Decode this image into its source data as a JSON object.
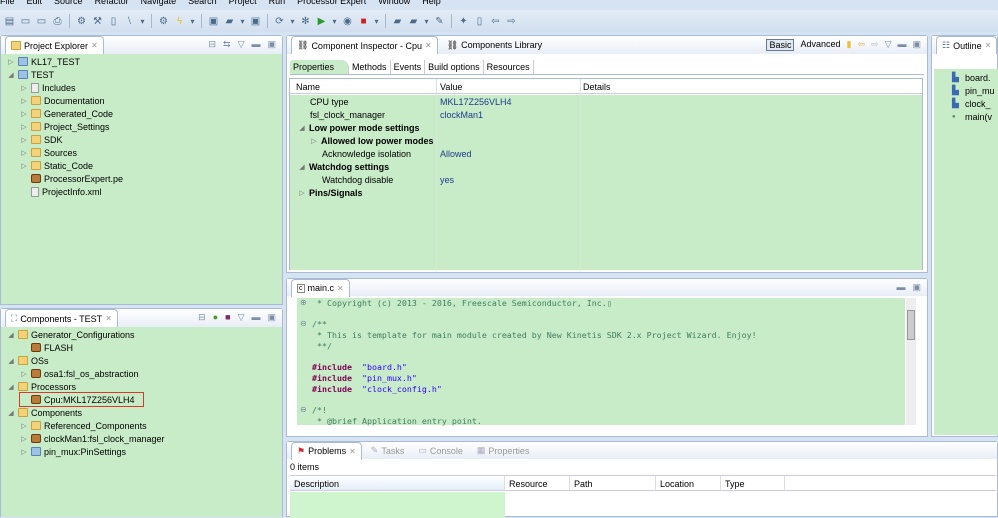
{
  "menu": [
    "File",
    "Edit",
    "Source",
    "Refactor",
    "Navigate",
    "Search",
    "Project",
    "Run",
    "Processor Expert",
    "Window",
    "Help"
  ],
  "toolbar_icons": [
    "new-icon",
    "save-icon",
    "save-all-icon",
    "print-icon",
    "build-config-icon",
    "hammer-icon",
    "binary-icon",
    "skip-breakpoints-icon",
    "external-tools-icon",
    "lightning-icon",
    "new-c-project-icon",
    "new-folder-icon",
    "new-class-icon",
    "refresh-icon",
    "debug-icon",
    "run-icon",
    "coverage-icon",
    "stop-icon",
    "open-icon",
    "open-folder-icon",
    "wrench-icon",
    "annotation-icon",
    "next-edit-icon",
    "back-icon",
    "forward-icon"
  ],
  "project_explorer": {
    "title": "Project Explorer",
    "items": [
      {
        "label": "KL17_TEST",
        "icon": "project",
        "depth": 0,
        "twisty": "collapsed"
      },
      {
        "label": "TEST",
        "icon": "project",
        "depth": 0,
        "twisty": "expanded"
      },
      {
        "label": "Includes",
        "icon": "includes",
        "depth": 1,
        "twisty": "collapsed"
      },
      {
        "label": "Documentation",
        "icon": "folder",
        "depth": 1,
        "twisty": "collapsed"
      },
      {
        "label": "Generated_Code",
        "icon": "folder",
        "depth": 1,
        "twisty": "collapsed"
      },
      {
        "label": "Project_Settings",
        "icon": "folder",
        "depth": 1,
        "twisty": "collapsed"
      },
      {
        "label": "SDK",
        "icon": "folder",
        "depth": 1,
        "twisty": "collapsed"
      },
      {
        "label": "Sources",
        "icon": "folder",
        "depth": 1,
        "twisty": "collapsed"
      },
      {
        "label": "Static_Code",
        "icon": "folder",
        "depth": 1,
        "twisty": "collapsed"
      },
      {
        "label": "ProcessorExpert.pe",
        "icon": "pe",
        "depth": 1,
        "twisty": ""
      },
      {
        "label": "ProjectInfo.xml",
        "icon": "file",
        "depth": 1,
        "twisty": ""
      }
    ]
  },
  "components": {
    "title": "Components - TEST",
    "items": [
      {
        "label": "Generator_Configurations",
        "icon": "folder",
        "depth": 0,
        "twisty": "expanded"
      },
      {
        "label": "FLASH",
        "icon": "gear",
        "depth": 1,
        "twisty": ""
      },
      {
        "label": "OSs",
        "icon": "folder",
        "depth": 0,
        "twisty": "expanded"
      },
      {
        "label": "osa1:fsl_os_abstraction",
        "icon": "component",
        "depth": 1,
        "twisty": "collapsed"
      },
      {
        "label": "Processors",
        "icon": "folder",
        "depth": 0,
        "twisty": "expanded"
      },
      {
        "label": "Cpu:MKL17Z256VLH4",
        "icon": "cpu",
        "depth": 1,
        "twisty": "",
        "highlighted": true
      },
      {
        "label": "Components",
        "icon": "folder",
        "depth": 0,
        "twisty": "expanded"
      },
      {
        "label": "Referenced_Components",
        "icon": "folder",
        "depth": 1,
        "twisty": "collapsed"
      },
      {
        "label": "clockMan1:fsl_clock_manager",
        "icon": "component",
        "depth": 1,
        "twisty": "collapsed"
      },
      {
        "label": "pin_mux:PinSettings",
        "icon": "pins",
        "depth": 1,
        "twisty": "collapsed"
      }
    ]
  },
  "inspector": {
    "tabs": [
      "Component Inspector - Cpu",
      "Components Library"
    ],
    "modes": [
      "Basic",
      "Advanced"
    ],
    "subtabs": [
      "Properties",
      "Methods",
      "Events",
      "Build options",
      "Resources"
    ],
    "columns": [
      "Name",
      "Value",
      "Details"
    ],
    "rows": [
      {
        "name": "CPU type",
        "value": "MKL17Z256VLH4",
        "depth": 1,
        "bold": false,
        "twisty": ""
      },
      {
        "name": "fsl_clock_manager",
        "value": "clockMan1",
        "depth": 1,
        "bold": false,
        "twisty": ""
      },
      {
        "name": "Low power mode settings",
        "value": "",
        "depth": 0,
        "bold": true,
        "twisty": "expanded"
      },
      {
        "name": "Allowed low power modes",
        "value": "",
        "depth": 1,
        "bold": true,
        "twisty": "collapsed"
      },
      {
        "name": "Acknowledge isolation",
        "value": "Allowed",
        "depth": 2,
        "bold": false,
        "twisty": ""
      },
      {
        "name": "Watchdog settings",
        "value": "",
        "depth": 0,
        "bold": true,
        "twisty": "expanded"
      },
      {
        "name": "Watchdog disable",
        "value": "yes",
        "depth": 2,
        "bold": false,
        "twisty": ""
      },
      {
        "name": "Pins/Signals",
        "value": "",
        "depth": 0,
        "bold": true,
        "twisty": "collapsed"
      }
    ]
  },
  "editor": {
    "tab": "main.c",
    "lines": [
      {
        "gutter": "+",
        "parts": [
          [
            "cm",
            " * Copyright (c) 2013 - 2016, Freescale Semiconductor, Inc.▯"
          ]
        ]
      },
      {
        "gutter": "",
        "parts": []
      },
      {
        "gutter": "-",
        "parts": [
          [
            "cm",
            "/**"
          ]
        ]
      },
      {
        "gutter": "",
        "parts": [
          [
            "cm",
            " * This is template for main module created by New Kinetis SDK 2.x Project Wizard. Enjoy!"
          ]
        ]
      },
      {
        "gutter": "",
        "parts": [
          [
            "cm",
            " **/"
          ]
        ]
      },
      {
        "gutter": "",
        "parts": []
      },
      {
        "gutter": "",
        "parts": [
          [
            "kw",
            "#include"
          ],
          [
            "",
            "  "
          ],
          [
            "str",
            "\"board.h\""
          ]
        ]
      },
      {
        "gutter": "",
        "parts": [
          [
            "kw",
            "#include"
          ],
          [
            "",
            "  "
          ],
          [
            "str",
            "\"pin_mux.h\""
          ]
        ]
      },
      {
        "gutter": "",
        "parts": [
          [
            "kw",
            "#include"
          ],
          [
            "",
            "  "
          ],
          [
            "str",
            "\"clock_config.h\""
          ]
        ]
      },
      {
        "gutter": "",
        "parts": []
      },
      {
        "gutter": "-",
        "parts": [
          [
            "cm",
            "/*!"
          ]
        ]
      },
      {
        "gutter": "",
        "parts": [
          [
            "cm",
            " * @brief Application entry point."
          ]
        ]
      }
    ]
  },
  "outline": {
    "title": "Outline",
    "items": [
      {
        "label": "board.",
        "icon": "include"
      },
      {
        "label": "pin_mu",
        "icon": "include"
      },
      {
        "label": "clock_",
        "icon": "include"
      },
      {
        "label": "main(v",
        "icon": "function"
      }
    ]
  },
  "problems": {
    "tabs": [
      "Problems",
      "Tasks",
      "Console",
      "Properties"
    ],
    "count": "0 items",
    "columns": [
      "Description",
      "Resource",
      "Path",
      "Location",
      "Type"
    ]
  },
  "colors": {
    "green": "#c8ebc8",
    "value_blue": "#1d3c8c",
    "highlight_red": "#d9382f"
  }
}
